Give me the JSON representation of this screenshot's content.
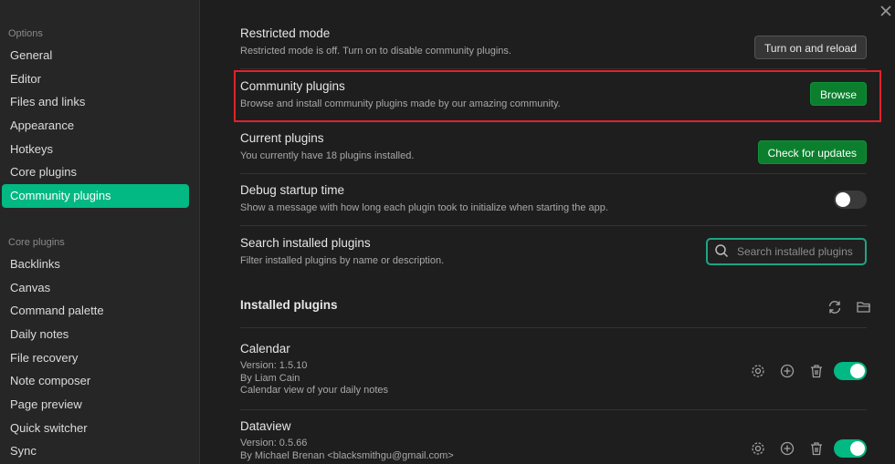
{
  "sidebar": {
    "options_heading": "Options",
    "options": [
      "General",
      "Editor",
      "Files and links",
      "Appearance",
      "Hotkeys",
      "Core plugins",
      "Community plugins"
    ],
    "core_heading": "Core plugins",
    "core": [
      "Backlinks",
      "Canvas",
      "Command palette",
      "Daily notes",
      "File recovery",
      "Note composer",
      "Page preview",
      "Quick switcher",
      "Sync"
    ]
  },
  "settings": {
    "restricted": {
      "name": "Restricted mode",
      "desc": "Restricted mode is off. Turn on to disable community plugins.",
      "button": "Turn on and reload"
    },
    "community": {
      "name": "Community plugins",
      "desc": "Browse and install community plugins made by our amazing community.",
      "button": "Browse"
    },
    "current": {
      "name": "Current plugins",
      "desc": "You currently have 18 plugins installed.",
      "button": "Check for updates"
    },
    "debug": {
      "name": "Debug startup time",
      "desc": "Show a message with how long each plugin took to initialize when starting the app."
    },
    "search": {
      "name": "Search installed plugins",
      "desc": "Filter installed plugins by name or description.",
      "placeholder": "Search installed plugins"
    }
  },
  "installed": {
    "heading": "Installed plugins",
    "plugins": [
      {
        "name": "Calendar",
        "version": "Version: 1.5.10",
        "author": "By Liam Cain",
        "desc": "Calendar view of your daily notes",
        "enabled": true
      },
      {
        "name": "Dataview",
        "version": "Version: 0.5.66",
        "author": "By Michael Brenan <blacksmithgu@gmail.com>",
        "desc": "",
        "enabled": true
      }
    ]
  },
  "colors": {
    "accent": "#02b883",
    "highlight": "#e0232b",
    "button_green": "#0b7f2e"
  }
}
